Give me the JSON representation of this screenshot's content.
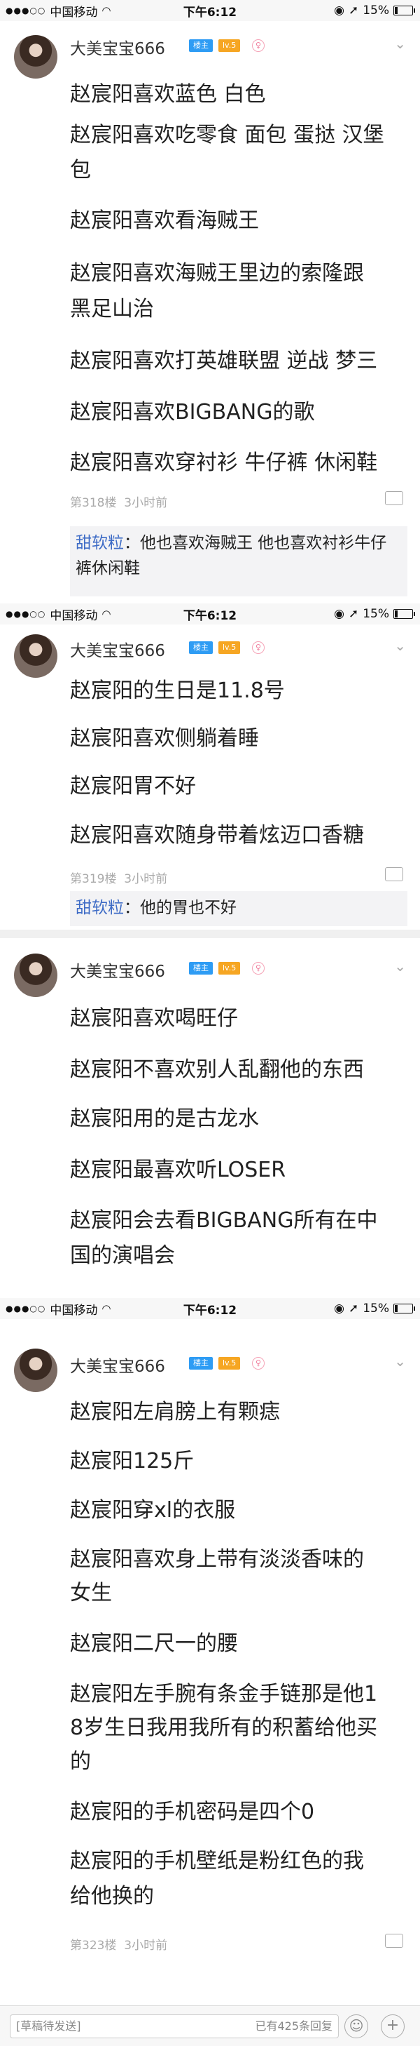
{
  "status": {
    "carrier": "中国移动",
    "time": "下午6:12",
    "battery": "15%",
    "battery_level": 0.15
  },
  "author": {
    "name": "大美宝宝666",
    "badge_owner": "楼主",
    "badge_level": "lv.5",
    "badge_gender": "♀"
  },
  "posts": [
    {
      "lines": [
        "赵宸阳喜欢蓝色 白色",
        "赵宸阳喜欢吃零食 面包 蛋挞 汉堡",
        "包",
        "赵宸阳喜欢看海贼王",
        "赵宸阳喜欢海贼王里边的索隆跟",
        "黑足山治",
        "赵宸阳喜欢打英雄联盟 逆战 梦三",
        "赵宸阳喜欢BIGBANG的歌",
        "赵宸阳喜欢穿衬衫 牛仔裤 休闲鞋"
      ],
      "floor": "第318楼",
      "time": "3小时前",
      "reply": {
        "who": "甜软粒",
        "text": "：他也喜欢海贼王 他也喜欢衬衫牛仔裤休闲鞋"
      }
    },
    {
      "lines": [
        "赵宸阳的生日是11.8号",
        "赵宸阳喜欢侧躺着睡",
        "赵宸阳胃不好",
        "赵宸阳喜欢随身带着炫迈口香糖"
      ],
      "floor": "第319楼",
      "time": "3小时前",
      "reply": {
        "who": "甜软粒",
        "text": "：他的胃也不好"
      }
    },
    {
      "lines": [
        "赵宸阳喜欢喝旺仔",
        "赵宸阳不喜欢别人乱翻他的东西",
        "赵宸阳用的是古龙水",
        "赵宸阳最喜欢听LOSER",
        "赵宸阳会去看BIGBANG所有在中",
        "国的演唱会"
      ]
    },
    {
      "lines": [
        "赵宸阳左肩膀上有颗痣",
        "赵宸阳125斤",
        "赵宸阳穿xl的衣服",
        "赵宸阳喜欢身上带有淡淡香味的",
        "女生",
        "赵宸阳二尺一的腰",
        "赵宸阳左手腕有条金手链那是他1",
        "8岁生日我用我所有的积蓄给他买",
        "的",
        "赵宸阳的手机密码是四个0",
        "赵宸阳的手机壁纸是粉红色的我",
        "给他换的"
      ],
      "floor": "第323楼",
      "time": "3小时前"
    }
  ],
  "bottom": {
    "draft": "[草稿待发送]",
    "count": "已有425条回复",
    "emoji": "☺",
    "plus": "+"
  }
}
